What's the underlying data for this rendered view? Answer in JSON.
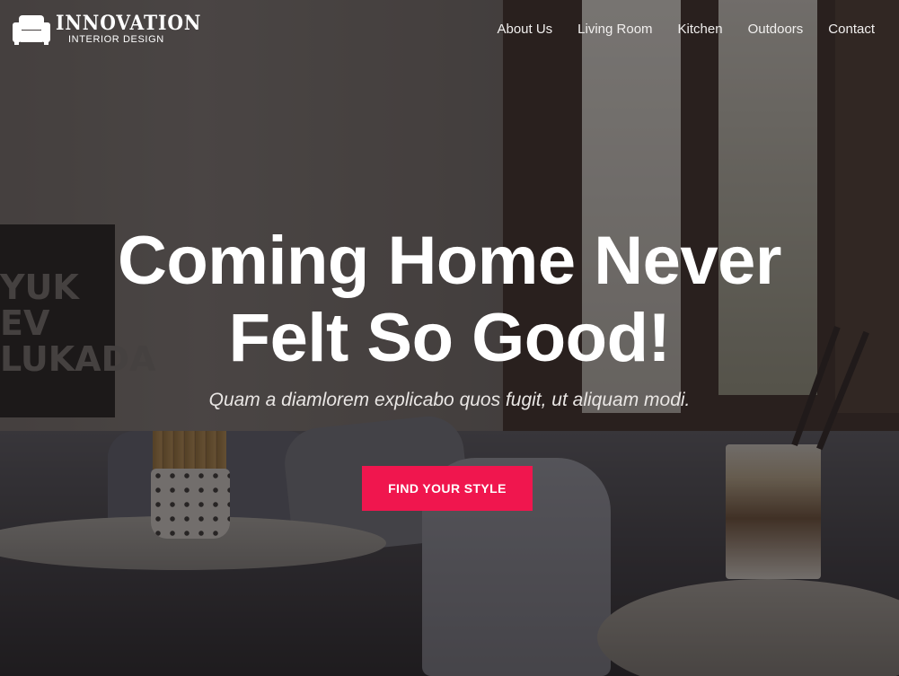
{
  "header": {
    "logo_title": "INNOVATION",
    "logo_subtitle": "INTERIOR DESIGN",
    "logo_icon": "sofa-icon"
  },
  "nav": {
    "items": [
      {
        "label": "About Us"
      },
      {
        "label": "Living Room"
      },
      {
        "label": "Kitchen"
      },
      {
        "label": "Outdoors"
      },
      {
        "label": "Contact"
      }
    ]
  },
  "hero": {
    "title_line_1": "Coming Home Never",
    "title_line_2": "Felt So Good!",
    "subtitle": "Quam a diamlorem explicabo quos fugit, ut aliquam modi.",
    "cta_label": "FIND YOUR STYLE"
  },
  "background": {
    "poster_text": "YUK\nEV\nLUKADA"
  },
  "colors": {
    "accent": "#f0164e",
    "text": "#ffffff",
    "overlay": "#141010"
  }
}
